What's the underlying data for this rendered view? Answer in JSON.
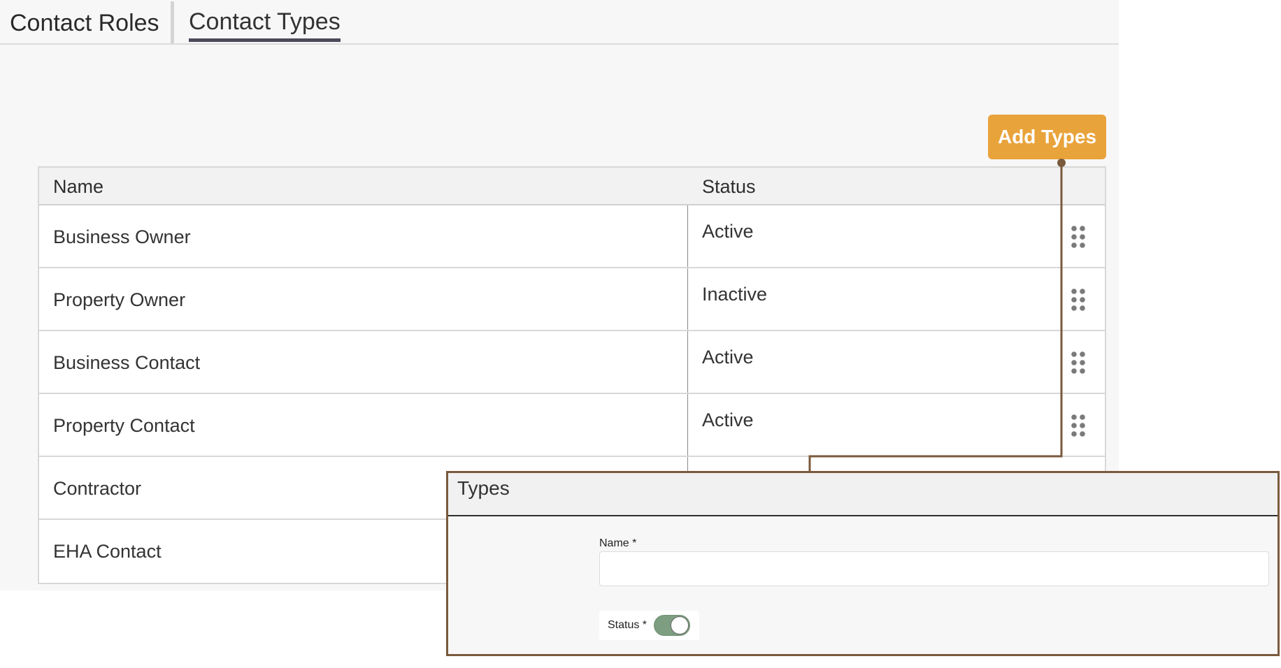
{
  "tabs": [
    {
      "label": "Contact Roles",
      "active": false
    },
    {
      "label": "Contact Types",
      "active": true
    }
  ],
  "toolbar": {
    "add_label": "Add Types"
  },
  "table": {
    "columns": [
      "Name",
      "Status"
    ],
    "rows": [
      {
        "name": "Business Owner",
        "status": "Active"
      },
      {
        "name": "Property Owner",
        "status": "Inactive"
      },
      {
        "name": "Business Contact",
        "status": "Active"
      },
      {
        "name": "Property Contact",
        "status": "Active"
      },
      {
        "name": "Contractor",
        "status": ""
      },
      {
        "name": "EHA Contact",
        "status": ""
      }
    ]
  },
  "modal": {
    "title": "Types",
    "name_label": "Name *",
    "name_value": "",
    "status_label": "Status *",
    "status_on": true
  },
  "colors": {
    "accent": "#e9a33b",
    "callout": "#7a5a3c",
    "toggle_on": "#7d9e80"
  },
  "icons": {
    "row_handle": "drag-handle-icon"
  }
}
